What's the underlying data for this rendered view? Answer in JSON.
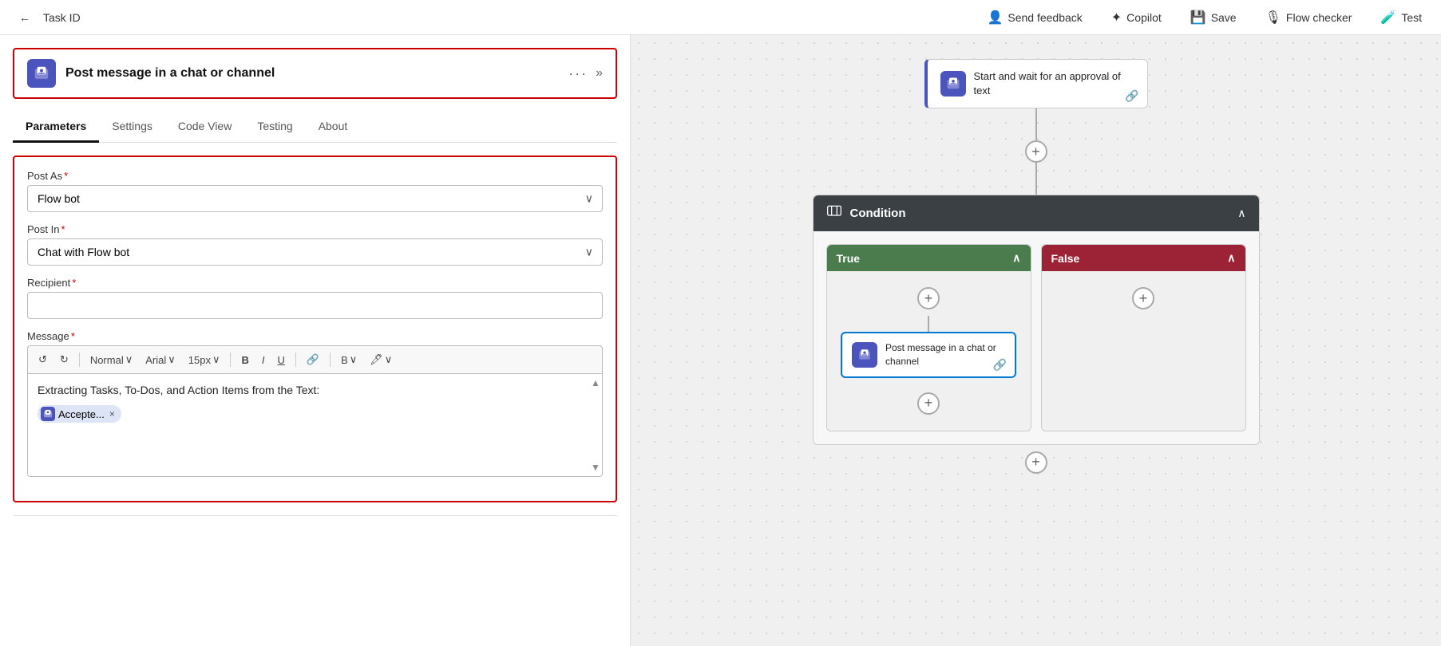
{
  "topNav": {
    "backLabel": "←",
    "title": "Task ID",
    "sendFeedback": "Send feedback",
    "copilot": "Copilot",
    "save": "Save",
    "flowChecker": "Flow checker",
    "test": "Test"
  },
  "leftPanel": {
    "actionTitle": "Post message in a chat or channel",
    "tabs": [
      {
        "id": "parameters",
        "label": "Parameters",
        "active": true
      },
      {
        "id": "settings",
        "label": "Settings",
        "active": false
      },
      {
        "id": "codeview",
        "label": "Code View",
        "active": false
      },
      {
        "id": "testing",
        "label": "Testing",
        "active": false
      },
      {
        "id": "about",
        "label": "About",
        "active": false
      }
    ],
    "form": {
      "postAs": {
        "label": "Post As",
        "required": true,
        "value": "Flow bot"
      },
      "postIn": {
        "label": "Post In",
        "required": true,
        "value": "Chat with Flow bot"
      },
      "recipient": {
        "label": "Recipient",
        "required": true,
        "value": ""
      },
      "message": {
        "label": "Message",
        "required": true,
        "toolbar": {
          "undo": "↺",
          "redo": "↻",
          "style": "Normal",
          "font": "Arial",
          "size": "15px",
          "bold": "B",
          "italic": "I",
          "underline": "U",
          "link": "🔗",
          "fontColor": "A",
          "highlight": "🖊"
        },
        "content": "Extracting Tasks, To-Dos, and Action Items from the Text:",
        "tag": {
          "label": "Accepte...",
          "icon": "⊡"
        }
      }
    }
  },
  "rightPanel": {
    "approvalNode": {
      "title": "Start and wait for an approval of text",
      "iconLabel": "⊡"
    },
    "conditionNode": {
      "title": "Condition",
      "iconLabel": "⊞"
    },
    "trueBranch": {
      "label": "True",
      "chevron": "∧"
    },
    "falseBranch": {
      "label": "False",
      "chevron": "∧"
    },
    "postMessageNode": {
      "title": "Post message in a chat or channel",
      "iconLabel": "⊡"
    }
  },
  "icons": {
    "teamsIcon": "⊡",
    "conditionIcon": "⊞",
    "linkIcon": "🔗",
    "chevronDown": "∨",
    "chevronUp": "∧",
    "collapseLeft": "»",
    "threeDots": "···",
    "plus": "+"
  }
}
